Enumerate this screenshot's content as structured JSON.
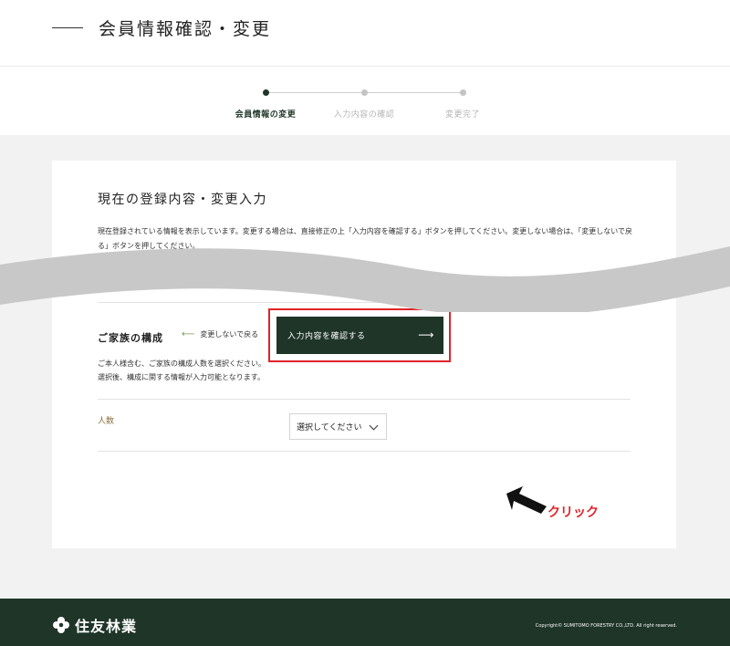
{
  "header": {
    "title": "会員情報確認・変更"
  },
  "steps": [
    {
      "label": "会員情報の変更",
      "active": true
    },
    {
      "label": "入力内容の確認",
      "active": false
    },
    {
      "label": "変更完了",
      "active": false
    }
  ],
  "section": {
    "title": "現在の登録内容・変更入力",
    "description": "現在登録されている情報を表示しています。変更する場合は、直接修正の上「入力内容を確認する」ボタンを押してください。変更しない場合は、「変更しないで戻る」ボタンを押してください。"
  },
  "family": {
    "title": "ご家族の構成",
    "description_line1": "ご本人様含む、ご家族の構成人数を選択ください。",
    "description_line2": "選択後、構成に関する情報が入力可能となります。",
    "field_label": "人数",
    "select_value": "選択してください"
  },
  "actions": {
    "back_label": "変更しないで戻る",
    "back_arrow": "⟵",
    "confirm_label": "入力内容を確認する",
    "confirm_arrow": "⟶"
  },
  "annotation": {
    "click_label": "クリック"
  },
  "footer": {
    "logo_text": "住友林業",
    "copyright": "Copyright© SUMITOMO FORESTRY CO.,LTD. All right reserved."
  },
  "colors": {
    "brand_green": "#1e3527",
    "highlight_red": "#e0242a",
    "step_active": "#1e3527",
    "step_inactive": "#bdbdbd"
  }
}
